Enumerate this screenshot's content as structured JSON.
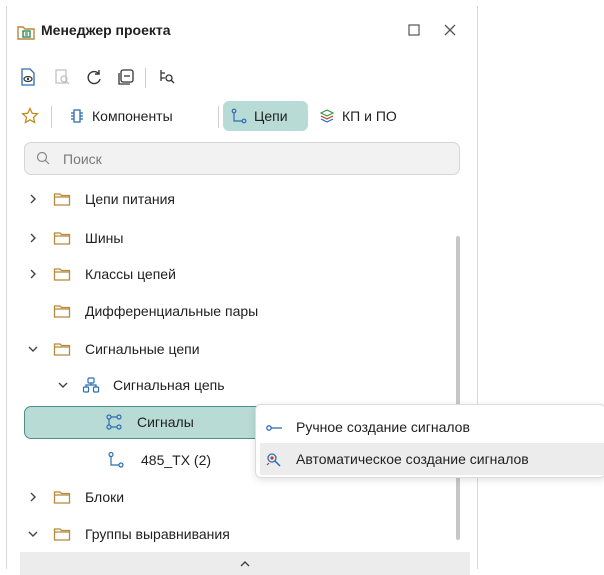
{
  "window": {
    "title": "Менеджер проекта"
  },
  "tabs": [
    {
      "label": "Компоненты",
      "active": false
    },
    {
      "label": "Цепи",
      "active": true
    },
    {
      "label": "КП и ПО",
      "active": false
    }
  ],
  "search": {
    "placeholder": "Поиск",
    "value": ""
  },
  "tree": [
    {
      "label": "Цепи питания",
      "expanded": false
    },
    {
      "label": "Шины",
      "expanded": false
    },
    {
      "label": "Классы цепей",
      "expanded": false
    },
    {
      "label": "Дифференциальные пары",
      "expanded": null
    },
    {
      "label": "Сигнальные цепи",
      "expanded": true
    },
    {
      "label": "Сигнальная цепь",
      "expanded": true
    },
    {
      "label": "Сигналы",
      "selected": true
    },
    {
      "label": "485_TX (2)"
    },
    {
      "label": "Блоки",
      "expanded": false
    },
    {
      "label": "Группы выравнивания",
      "expanded": true
    }
  ],
  "context_menu": {
    "items": [
      {
        "label": "Ручное создание сигналов",
        "icon": "manual-signal-icon"
      },
      {
        "label": "Автоматическое создание сигналов",
        "icon": "auto-signal-icon",
        "highlighted": true
      }
    ]
  },
  "colors": {
    "accent": "#4f8f86",
    "selected_bg": "#b9dbd6",
    "folder": "#b8893a"
  }
}
